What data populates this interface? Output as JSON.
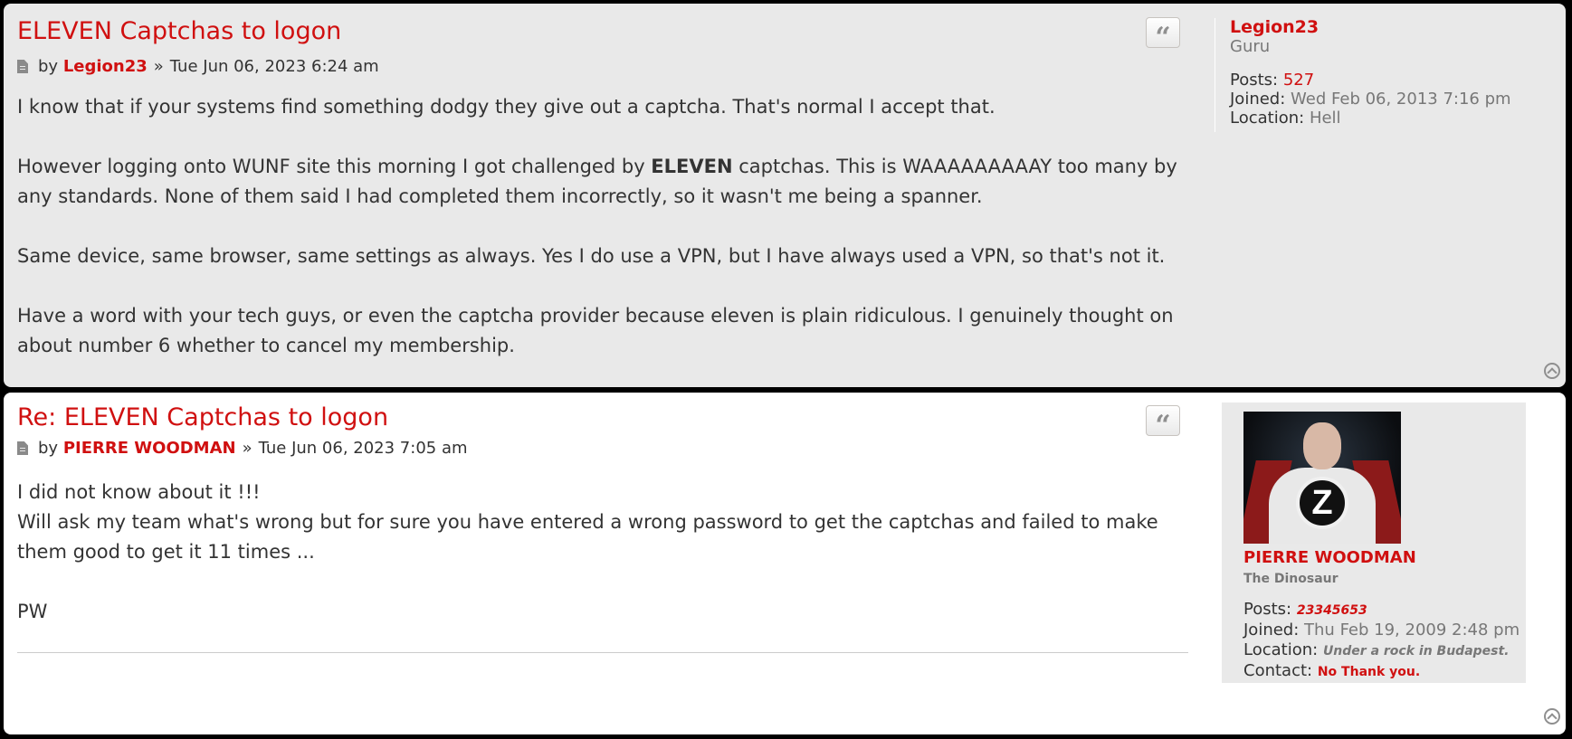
{
  "posts": [
    {
      "title": "ELEVEN Captchas to logon",
      "by_label": "by",
      "author": "Legion23",
      "separator": "»",
      "date": "Tue Jun 06, 2023 6:24 am",
      "paragraphs": [
        "I know that if your systems find something dodgy they give out a captcha. That's normal I accept that.",
        "",
        "Same device, same browser, same settings as always. Yes I do use a VPN, but I have always used a VPN, so that's not it.",
        "Have a word with your tech guys, or even the captcha provider because eleven is plain ridiculous. I genuinely thought on about number 6 whether to cancel my membership."
      ],
      "p2_before": "However logging onto WUNF site this morning I got challenged by ",
      "p2_bold": "ELEVEN",
      "p2_after": " captchas. This is WAAAAAAAAAY too many by any standards. None of them said I had completed them incorrectly, so it wasn't me being a spanner.",
      "quote_icon": "quote-icon",
      "profile": {
        "name": "Legion23",
        "rank": "Guru",
        "posts_label": "Posts:",
        "posts_value": "527",
        "joined_label": "Joined:",
        "joined_value": "Wed Feb 06, 2013 7:16 pm",
        "location_label": "Location:",
        "location_value": "Hell"
      }
    },
    {
      "title": "Re: ELEVEN Captchas to logon",
      "by_label": "by",
      "author": "PIERRE WOODMAN",
      "separator": "»",
      "date": "Tue Jun 06, 2023 7:05 am",
      "lines": [
        "I did not know about it !!!",
        "Will ask my team what's wrong but for sure you have entered a wrong password to get the captchas and failed to make them good to get it 11 times ...",
        "",
        "PW"
      ],
      "quote_icon": "quote-icon",
      "profile": {
        "avatar_letter": "Z",
        "name": "PIERRE WOODMAN",
        "rank": "The Dinosaur",
        "posts_label": "Posts:",
        "posts_value": "23345653",
        "joined_label": "Joined:",
        "joined_value": "Thu Feb 19, 2009 2:48 pm",
        "location_label": "Location:",
        "location_value": "Under a rock in Budapest.",
        "contact_label": "Contact:",
        "contact_value": "No Thank you."
      }
    }
  ],
  "colors": {
    "accent": "#d01010",
    "post1_bg": "#e9e9e9",
    "post2_bg": "#ffffff",
    "text": "#333333",
    "muted": "#777777"
  },
  "icons": [
    "file-icon",
    "quote-icon",
    "back-to-top-icon"
  ]
}
